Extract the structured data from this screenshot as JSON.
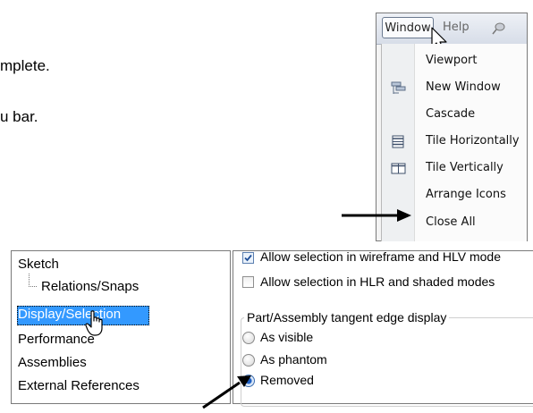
{
  "instructions": {
    "fragment_1": "mplete.",
    "fragment_2": "u bar."
  },
  "menu_screenshot": {
    "menubar": {
      "window_label": "Window",
      "help_label": "Help"
    },
    "items": [
      {
        "label": "Viewport",
        "icon": "none"
      },
      {
        "label": "New Window",
        "icon": "new-window-icon"
      },
      {
        "label": "Cascade",
        "icon": "none"
      },
      {
        "label": "Tile Horizontally",
        "icon": "tile-horizontally-icon"
      },
      {
        "label": "Tile Vertically",
        "icon": "tile-vertically-icon"
      },
      {
        "label": "Arrange Icons",
        "icon": "none"
      },
      {
        "label": "Close All",
        "icon": "none"
      }
    ]
  },
  "options_screenshot": {
    "tree": [
      {
        "label": "Sketch"
      },
      {
        "label": "Relations/Snaps"
      },
      {
        "label": "Display/Selection",
        "selected": true
      },
      {
        "label": "Performance"
      },
      {
        "label": "Assemblies"
      },
      {
        "label": "External References"
      }
    ],
    "checkboxes": [
      {
        "label": "Allow selection in wireframe and HLV mode",
        "checked": true
      },
      {
        "label": "Allow selection in HLR and shaded modes",
        "checked": false
      }
    ],
    "group": {
      "title": "Part/Assembly tangent edge display",
      "options": [
        {
          "label": "As visible",
          "selected": false
        },
        {
          "label": "As phantom",
          "selected": false
        },
        {
          "label": "Removed",
          "selected": true
        }
      ]
    }
  },
  "colors": {
    "selection": "#3399ff",
    "menubar": "#dfe4ec",
    "arrow": "#000000"
  }
}
